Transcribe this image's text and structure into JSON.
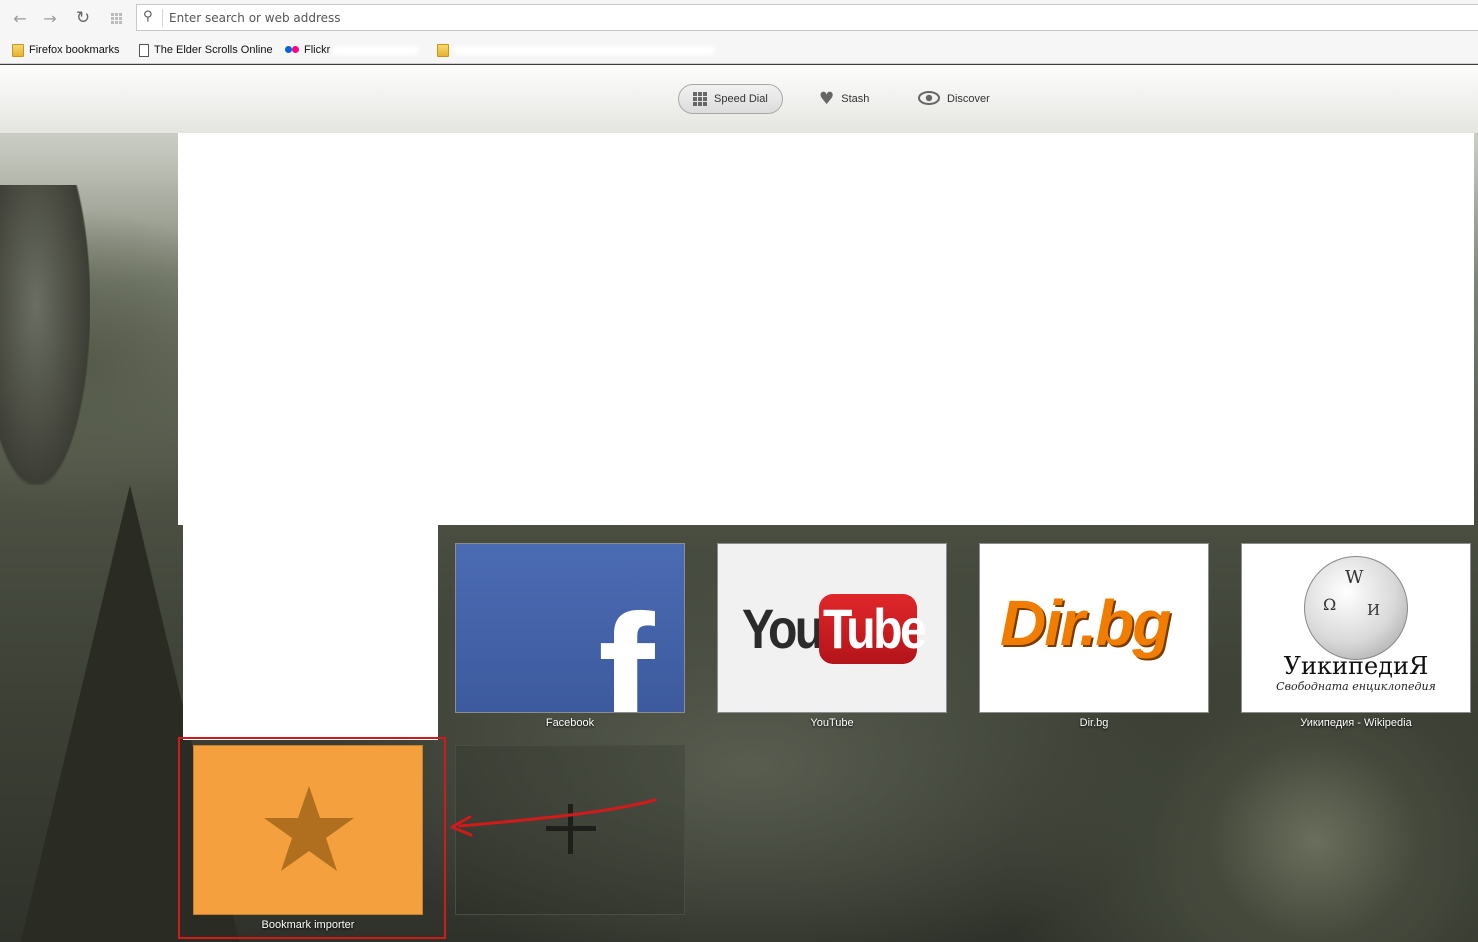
{
  "toolbar": {
    "back_icon": "back-arrow-icon",
    "forward_icon": "forward-arrow-icon",
    "reload_icon": "reload-icon",
    "apps_icon": "grid-icon",
    "search_placeholder": "Enter search or web address"
  },
  "bookmarks": [
    {
      "label": "Firefox bookmarks",
      "icon": "folder-icon"
    },
    {
      "label": "The Elder Scrolls Online",
      "icon": "page-icon"
    },
    {
      "label": "Flickr",
      "icon": "flickr-icon"
    }
  ],
  "tabs": [
    {
      "label": "Speed Dial",
      "icon": "speed-dial-grid-icon",
      "active": true
    },
    {
      "label": "Stash",
      "icon": "heart-icon",
      "active": false
    },
    {
      "label": "Discover",
      "icon": "eye-icon",
      "active": false
    }
  ],
  "tiles": [
    {
      "label": "Facebook"
    },
    {
      "label": "YouTube",
      "you": "You",
      "tube": "Tube"
    },
    {
      "label": "Dir.bg",
      "logo": "Dir.bg"
    },
    {
      "label": "Уикипедия - Wikipedia",
      "title": "УикипедиЯ",
      "subtitle": "Свободната енциклопедия"
    },
    {
      "label": "Bookmark importer",
      "icon": "star-icon",
      "color": "#f4a03e"
    },
    {
      "label": "",
      "icon": "plus-icon"
    }
  ],
  "colors": {
    "highlight_border": "#d11b1b",
    "bookmark_tile": "#f4a03e",
    "facebook": "#3d5a9e",
    "youtube_red": "#cc181e"
  }
}
